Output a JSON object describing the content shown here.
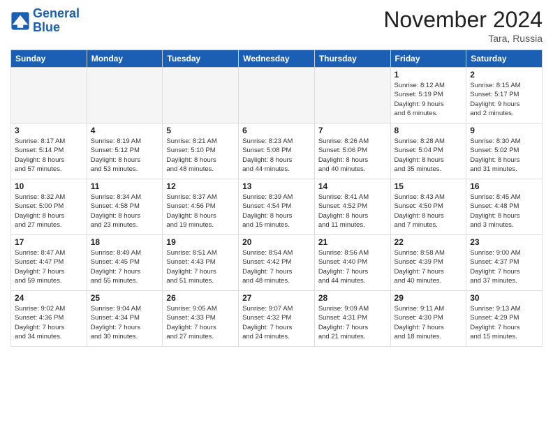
{
  "logo": {
    "line1": "General",
    "line2": "Blue"
  },
  "title": "November 2024",
  "subtitle": "Tara, Russia",
  "headers": [
    "Sunday",
    "Monday",
    "Tuesday",
    "Wednesday",
    "Thursday",
    "Friday",
    "Saturday"
  ],
  "weeks": [
    [
      {
        "day": "",
        "info": ""
      },
      {
        "day": "",
        "info": ""
      },
      {
        "day": "",
        "info": ""
      },
      {
        "day": "",
        "info": ""
      },
      {
        "day": "",
        "info": ""
      },
      {
        "day": "1",
        "info": "Sunrise: 8:12 AM\nSunset: 5:19 PM\nDaylight: 9 hours\nand 6 minutes."
      },
      {
        "day": "2",
        "info": "Sunrise: 8:15 AM\nSunset: 5:17 PM\nDaylight: 9 hours\nand 2 minutes."
      }
    ],
    [
      {
        "day": "3",
        "info": "Sunrise: 8:17 AM\nSunset: 5:14 PM\nDaylight: 8 hours\nand 57 minutes."
      },
      {
        "day": "4",
        "info": "Sunrise: 8:19 AM\nSunset: 5:12 PM\nDaylight: 8 hours\nand 53 minutes."
      },
      {
        "day": "5",
        "info": "Sunrise: 8:21 AM\nSunset: 5:10 PM\nDaylight: 8 hours\nand 48 minutes."
      },
      {
        "day": "6",
        "info": "Sunrise: 8:23 AM\nSunset: 5:08 PM\nDaylight: 8 hours\nand 44 minutes."
      },
      {
        "day": "7",
        "info": "Sunrise: 8:26 AM\nSunset: 5:06 PM\nDaylight: 8 hours\nand 40 minutes."
      },
      {
        "day": "8",
        "info": "Sunrise: 8:28 AM\nSunset: 5:04 PM\nDaylight: 8 hours\nand 35 minutes."
      },
      {
        "day": "9",
        "info": "Sunrise: 8:30 AM\nSunset: 5:02 PM\nDaylight: 8 hours\nand 31 minutes."
      }
    ],
    [
      {
        "day": "10",
        "info": "Sunrise: 8:32 AM\nSunset: 5:00 PM\nDaylight: 8 hours\nand 27 minutes."
      },
      {
        "day": "11",
        "info": "Sunrise: 8:34 AM\nSunset: 4:58 PM\nDaylight: 8 hours\nand 23 minutes."
      },
      {
        "day": "12",
        "info": "Sunrise: 8:37 AM\nSunset: 4:56 PM\nDaylight: 8 hours\nand 19 minutes."
      },
      {
        "day": "13",
        "info": "Sunrise: 8:39 AM\nSunset: 4:54 PM\nDaylight: 8 hours\nand 15 minutes."
      },
      {
        "day": "14",
        "info": "Sunrise: 8:41 AM\nSunset: 4:52 PM\nDaylight: 8 hours\nand 11 minutes."
      },
      {
        "day": "15",
        "info": "Sunrise: 8:43 AM\nSunset: 4:50 PM\nDaylight: 8 hours\nand 7 minutes."
      },
      {
        "day": "16",
        "info": "Sunrise: 8:45 AM\nSunset: 4:48 PM\nDaylight: 8 hours\nand 3 minutes."
      }
    ],
    [
      {
        "day": "17",
        "info": "Sunrise: 8:47 AM\nSunset: 4:47 PM\nDaylight: 7 hours\nand 59 minutes."
      },
      {
        "day": "18",
        "info": "Sunrise: 8:49 AM\nSunset: 4:45 PM\nDaylight: 7 hours\nand 55 minutes."
      },
      {
        "day": "19",
        "info": "Sunrise: 8:51 AM\nSunset: 4:43 PM\nDaylight: 7 hours\nand 51 minutes."
      },
      {
        "day": "20",
        "info": "Sunrise: 8:54 AM\nSunset: 4:42 PM\nDaylight: 7 hours\nand 48 minutes."
      },
      {
        "day": "21",
        "info": "Sunrise: 8:56 AM\nSunset: 4:40 PM\nDaylight: 7 hours\nand 44 minutes."
      },
      {
        "day": "22",
        "info": "Sunrise: 8:58 AM\nSunset: 4:39 PM\nDaylight: 7 hours\nand 40 minutes."
      },
      {
        "day": "23",
        "info": "Sunrise: 9:00 AM\nSunset: 4:37 PM\nDaylight: 7 hours\nand 37 minutes."
      }
    ],
    [
      {
        "day": "24",
        "info": "Sunrise: 9:02 AM\nSunset: 4:36 PM\nDaylight: 7 hours\nand 34 minutes."
      },
      {
        "day": "25",
        "info": "Sunrise: 9:04 AM\nSunset: 4:34 PM\nDaylight: 7 hours\nand 30 minutes."
      },
      {
        "day": "26",
        "info": "Sunrise: 9:05 AM\nSunset: 4:33 PM\nDaylight: 7 hours\nand 27 minutes."
      },
      {
        "day": "27",
        "info": "Sunrise: 9:07 AM\nSunset: 4:32 PM\nDaylight: 7 hours\nand 24 minutes."
      },
      {
        "day": "28",
        "info": "Sunrise: 9:09 AM\nSunset: 4:31 PM\nDaylight: 7 hours\nand 21 minutes."
      },
      {
        "day": "29",
        "info": "Sunrise: 9:11 AM\nSunset: 4:30 PM\nDaylight: 7 hours\nand 18 minutes."
      },
      {
        "day": "30",
        "info": "Sunrise: 9:13 AM\nSunset: 4:29 PM\nDaylight: 7 hours\nand 15 minutes."
      }
    ]
  ]
}
